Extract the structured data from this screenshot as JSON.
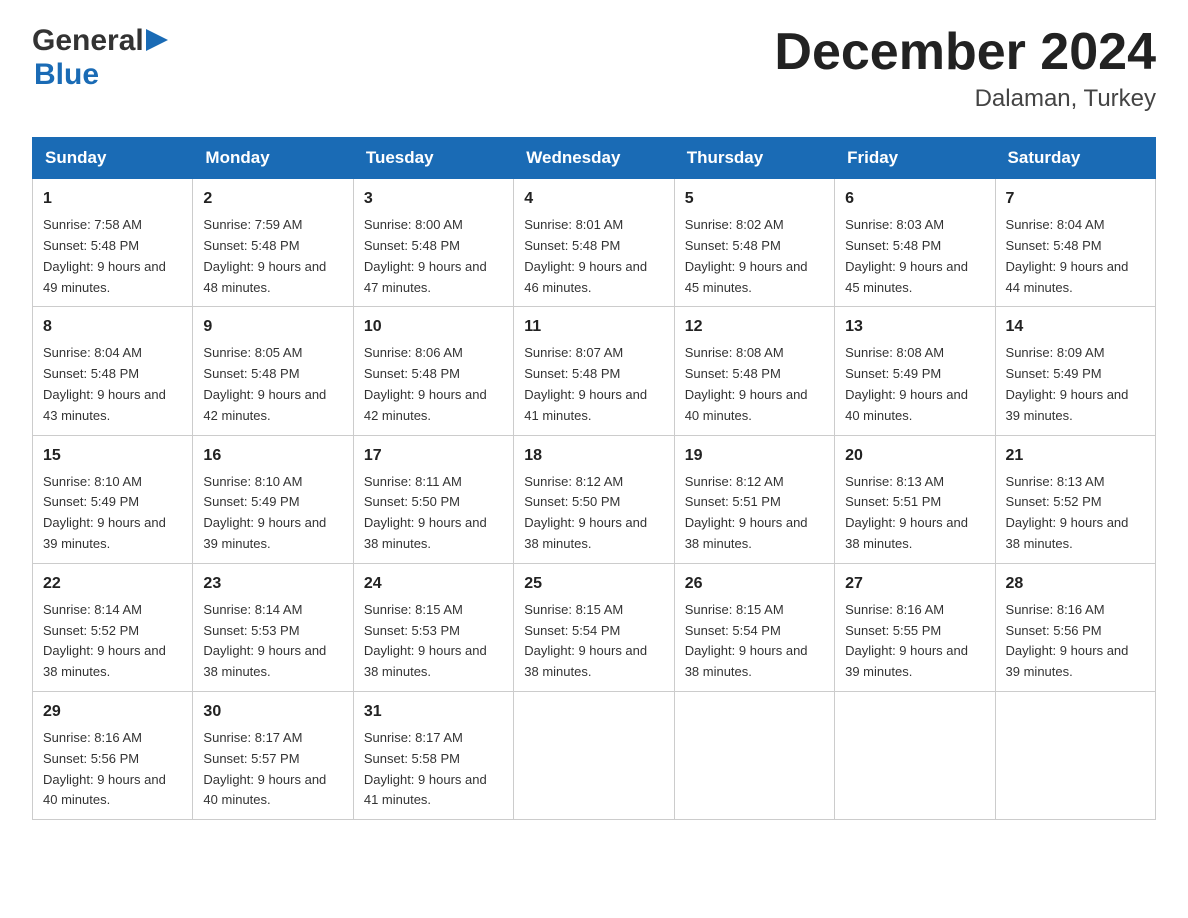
{
  "logo": {
    "general_text": "General",
    "blue_text": "Blue"
  },
  "title": {
    "month": "December 2024",
    "location": "Dalaman, Turkey"
  },
  "weekdays": [
    "Sunday",
    "Monday",
    "Tuesday",
    "Wednesday",
    "Thursday",
    "Friday",
    "Saturday"
  ],
  "weeks": [
    [
      {
        "day": "1",
        "sunrise": "Sunrise: 7:58 AM",
        "sunset": "Sunset: 5:48 PM",
        "daylight": "Daylight: 9 hours and 49 minutes."
      },
      {
        "day": "2",
        "sunrise": "Sunrise: 7:59 AM",
        "sunset": "Sunset: 5:48 PM",
        "daylight": "Daylight: 9 hours and 48 minutes."
      },
      {
        "day": "3",
        "sunrise": "Sunrise: 8:00 AM",
        "sunset": "Sunset: 5:48 PM",
        "daylight": "Daylight: 9 hours and 47 minutes."
      },
      {
        "day": "4",
        "sunrise": "Sunrise: 8:01 AM",
        "sunset": "Sunset: 5:48 PM",
        "daylight": "Daylight: 9 hours and 46 minutes."
      },
      {
        "day": "5",
        "sunrise": "Sunrise: 8:02 AM",
        "sunset": "Sunset: 5:48 PM",
        "daylight": "Daylight: 9 hours and 45 minutes."
      },
      {
        "day": "6",
        "sunrise": "Sunrise: 8:03 AM",
        "sunset": "Sunset: 5:48 PM",
        "daylight": "Daylight: 9 hours and 45 minutes."
      },
      {
        "day": "7",
        "sunrise": "Sunrise: 8:04 AM",
        "sunset": "Sunset: 5:48 PM",
        "daylight": "Daylight: 9 hours and 44 minutes."
      }
    ],
    [
      {
        "day": "8",
        "sunrise": "Sunrise: 8:04 AM",
        "sunset": "Sunset: 5:48 PM",
        "daylight": "Daylight: 9 hours and 43 minutes."
      },
      {
        "day": "9",
        "sunrise": "Sunrise: 8:05 AM",
        "sunset": "Sunset: 5:48 PM",
        "daylight": "Daylight: 9 hours and 42 minutes."
      },
      {
        "day": "10",
        "sunrise": "Sunrise: 8:06 AM",
        "sunset": "Sunset: 5:48 PM",
        "daylight": "Daylight: 9 hours and 42 minutes."
      },
      {
        "day": "11",
        "sunrise": "Sunrise: 8:07 AM",
        "sunset": "Sunset: 5:48 PM",
        "daylight": "Daylight: 9 hours and 41 minutes."
      },
      {
        "day": "12",
        "sunrise": "Sunrise: 8:08 AM",
        "sunset": "Sunset: 5:48 PM",
        "daylight": "Daylight: 9 hours and 40 minutes."
      },
      {
        "day": "13",
        "sunrise": "Sunrise: 8:08 AM",
        "sunset": "Sunset: 5:49 PM",
        "daylight": "Daylight: 9 hours and 40 minutes."
      },
      {
        "day": "14",
        "sunrise": "Sunrise: 8:09 AM",
        "sunset": "Sunset: 5:49 PM",
        "daylight": "Daylight: 9 hours and 39 minutes."
      }
    ],
    [
      {
        "day": "15",
        "sunrise": "Sunrise: 8:10 AM",
        "sunset": "Sunset: 5:49 PM",
        "daylight": "Daylight: 9 hours and 39 minutes."
      },
      {
        "day": "16",
        "sunrise": "Sunrise: 8:10 AM",
        "sunset": "Sunset: 5:49 PM",
        "daylight": "Daylight: 9 hours and 39 minutes."
      },
      {
        "day": "17",
        "sunrise": "Sunrise: 8:11 AM",
        "sunset": "Sunset: 5:50 PM",
        "daylight": "Daylight: 9 hours and 38 minutes."
      },
      {
        "day": "18",
        "sunrise": "Sunrise: 8:12 AM",
        "sunset": "Sunset: 5:50 PM",
        "daylight": "Daylight: 9 hours and 38 minutes."
      },
      {
        "day": "19",
        "sunrise": "Sunrise: 8:12 AM",
        "sunset": "Sunset: 5:51 PM",
        "daylight": "Daylight: 9 hours and 38 minutes."
      },
      {
        "day": "20",
        "sunrise": "Sunrise: 8:13 AM",
        "sunset": "Sunset: 5:51 PM",
        "daylight": "Daylight: 9 hours and 38 minutes."
      },
      {
        "day": "21",
        "sunrise": "Sunrise: 8:13 AM",
        "sunset": "Sunset: 5:52 PM",
        "daylight": "Daylight: 9 hours and 38 minutes."
      }
    ],
    [
      {
        "day": "22",
        "sunrise": "Sunrise: 8:14 AM",
        "sunset": "Sunset: 5:52 PM",
        "daylight": "Daylight: 9 hours and 38 minutes."
      },
      {
        "day": "23",
        "sunrise": "Sunrise: 8:14 AM",
        "sunset": "Sunset: 5:53 PM",
        "daylight": "Daylight: 9 hours and 38 minutes."
      },
      {
        "day": "24",
        "sunrise": "Sunrise: 8:15 AM",
        "sunset": "Sunset: 5:53 PM",
        "daylight": "Daylight: 9 hours and 38 minutes."
      },
      {
        "day": "25",
        "sunrise": "Sunrise: 8:15 AM",
        "sunset": "Sunset: 5:54 PM",
        "daylight": "Daylight: 9 hours and 38 minutes."
      },
      {
        "day": "26",
        "sunrise": "Sunrise: 8:15 AM",
        "sunset": "Sunset: 5:54 PM",
        "daylight": "Daylight: 9 hours and 38 minutes."
      },
      {
        "day": "27",
        "sunrise": "Sunrise: 8:16 AM",
        "sunset": "Sunset: 5:55 PM",
        "daylight": "Daylight: 9 hours and 39 minutes."
      },
      {
        "day": "28",
        "sunrise": "Sunrise: 8:16 AM",
        "sunset": "Sunset: 5:56 PM",
        "daylight": "Daylight: 9 hours and 39 minutes."
      }
    ],
    [
      {
        "day": "29",
        "sunrise": "Sunrise: 8:16 AM",
        "sunset": "Sunset: 5:56 PM",
        "daylight": "Daylight: 9 hours and 40 minutes."
      },
      {
        "day": "30",
        "sunrise": "Sunrise: 8:17 AM",
        "sunset": "Sunset: 5:57 PM",
        "daylight": "Daylight: 9 hours and 40 minutes."
      },
      {
        "day": "31",
        "sunrise": "Sunrise: 8:17 AM",
        "sunset": "Sunset: 5:58 PM",
        "daylight": "Daylight: 9 hours and 41 minutes."
      },
      null,
      null,
      null,
      null
    ]
  ]
}
